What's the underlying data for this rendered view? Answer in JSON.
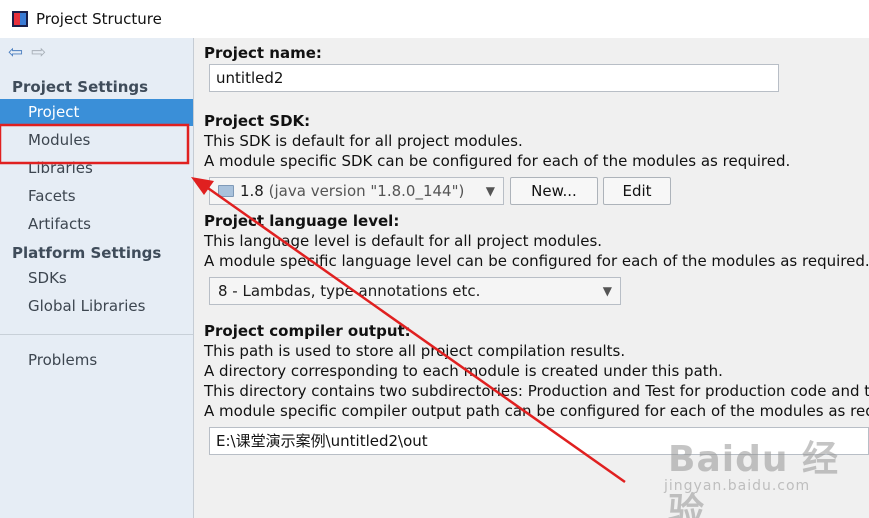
{
  "window": {
    "title": "Project Structure"
  },
  "sidebar": {
    "project_settings_title": "Project Settings",
    "project_items": [
      "Project",
      "Modules",
      "Libraries",
      "Facets",
      "Artifacts"
    ],
    "platform_settings_title": "Platform Settings",
    "platform_items": [
      "SDKs",
      "Global Libraries"
    ],
    "problems": "Problems",
    "selected": "Project"
  },
  "main": {
    "project_name": {
      "label": "Project name:",
      "value": "untitled2"
    },
    "sdk": {
      "label": "Project SDK:",
      "desc1": "This SDK is default for all project modules.",
      "desc2": "A module specific SDK can be configured for each of the modules as required.",
      "selected_version": "1.8",
      "selected_detail": "(java version \"1.8.0_144\")",
      "new_button": "New...",
      "edit_button": "Edit"
    },
    "language_level": {
      "label": "Project language level:",
      "desc1": "This language level is default for all project modules.",
      "desc2": "A module specific language level can be configured for each of the modules as required.",
      "selected": "8 - Lambdas, type annotations etc."
    },
    "compiler_output": {
      "label": "Project compiler output:",
      "desc1": "This path is used to store all project compilation results.",
      "desc2": "A directory corresponding to each module is created under this path.",
      "desc3": "This directory contains two subdirectories: Production and Test for production code and tes",
      "desc4": "A module specific compiler output path can be configured for each of the modules as requi",
      "path": "E:\\课堂演示案例\\untitled2\\out"
    }
  },
  "watermark": {
    "brand": "Baidu 经验",
    "url": "jingyan.baidu.com"
  },
  "colors": {
    "selection": "#3a8fd8",
    "annotation": "#e02020",
    "sidebar_bg": "#e6edf5"
  }
}
